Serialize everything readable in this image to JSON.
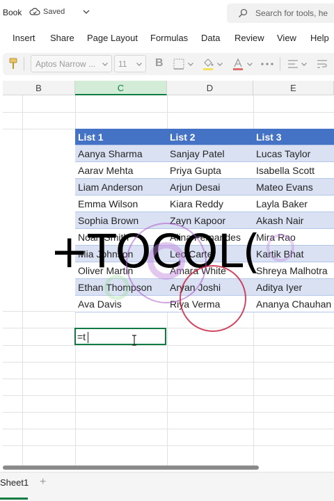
{
  "titlebar": {
    "title": "Book",
    "saved_label": "Saved",
    "search_placeholder": "Search for tools, he"
  },
  "menu": {
    "items": [
      "Insert",
      "Share",
      "Page Layout",
      "Formulas",
      "Data",
      "Review",
      "View",
      "Help"
    ]
  },
  "toolbar": {
    "font_name": "Aptos Narrow ...",
    "font_size": "11",
    "bold_label": "B"
  },
  "grid": {
    "columns": [
      "B",
      "C",
      "D",
      "E"
    ],
    "selected_column": "C",
    "table": {
      "headers": [
        "List 1",
        "List 2",
        "List 3"
      ],
      "rows": [
        [
          "Aanya Sharma",
          "Sanjay Patel",
          "Lucas Taylor"
        ],
        [
          "Aarav Mehta",
          "Priya Gupta",
          "Isabella Scott"
        ],
        [
          "Liam Anderson",
          "Arjun Desai",
          "Mateo Evans"
        ],
        [
          "Emma Wilson",
          "Kiara Reddy",
          "Layla Baker"
        ],
        [
          "Sophia Brown",
          "Zayn Kapoor",
          "Akash Nair"
        ],
        [
          "Noah Smith",
          "Alina Fernandes",
          "Mira Rao"
        ],
        [
          "Mia Johnson",
          "Leo Carter",
          "Kartik Bhat"
        ],
        [
          "Oliver Martin",
          "Amara White",
          "Shreya Malhotra"
        ],
        [
          "Ethan Thompson",
          "Aryan Joshi",
          "Aditya Iyer"
        ],
        [
          "Ava Davis",
          "Riya Verma",
          "Ananya Chauhan"
        ]
      ]
    },
    "active_cell_value": "=t"
  },
  "overlay": {
    "text": "+TOCOL("
  },
  "sheets": {
    "tabs": [
      "Sheet1"
    ],
    "add_label": "+"
  },
  "colors": {
    "accent_green": "#107c41",
    "table_header": "#4472c4",
    "table_band": "#d9e1f2"
  }
}
